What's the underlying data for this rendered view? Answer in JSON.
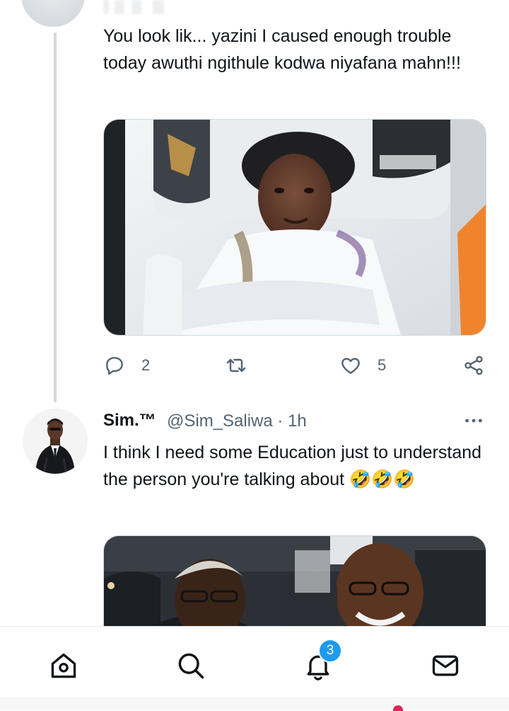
{
  "reply_tweet": {
    "text": "You look lik... yazini I caused enough trouble today awuthi ngithule kodwa niyafana mahn!!!",
    "replies": "2",
    "likes": "5"
  },
  "next_tweet": {
    "name": "Sim.™",
    "handle": "@Sim_Saliwa",
    "time": "· 1h",
    "text": "I think I need some Education just to understand the person you're talking about 🤣🤣🤣"
  },
  "icons": {
    "reply": "reply-icon",
    "retweet": "retweet-icon",
    "like": "heart-icon",
    "share": "share-icon",
    "more": "more-icon",
    "home": "home-icon",
    "search": "search-icon",
    "notifications": "bell-icon",
    "messages": "mail-icon"
  },
  "nav": {
    "notification_badge": "3"
  },
  "colors": {
    "text": "#0f1419",
    "muted": "#536471",
    "accent": "#1d9bf0",
    "border": "#cfd9de"
  }
}
